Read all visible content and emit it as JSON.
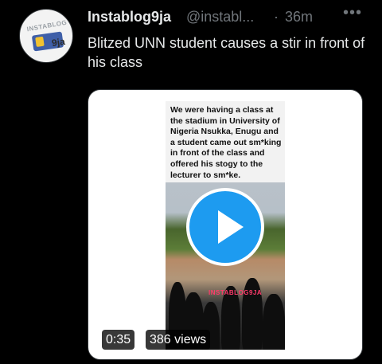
{
  "tweet": {
    "author_name": "Instablog9ja",
    "author_handle": "@instabl...",
    "separator": "·",
    "time": "36m",
    "more": "•••",
    "text": "Blitzed UNN student causes a stir in front of his class"
  },
  "avatar": {
    "logo_top": "INSTABLOG",
    "logo_text": "9ja"
  },
  "media": {
    "caption": "We were having a class at the stadium in University of Nigeria Nsukka, Enugu and a student came out sm*king in front of the class and offered his stogy to the lecturer to sm*ke.",
    "watermark": "INSTABLOG9JA",
    "duration": "0:35",
    "views": "386 views"
  },
  "colors": {
    "background": "#000000",
    "text_primary": "#e7e9ea",
    "text_secondary": "#71767b",
    "play_accent": "#1d9bf0"
  }
}
